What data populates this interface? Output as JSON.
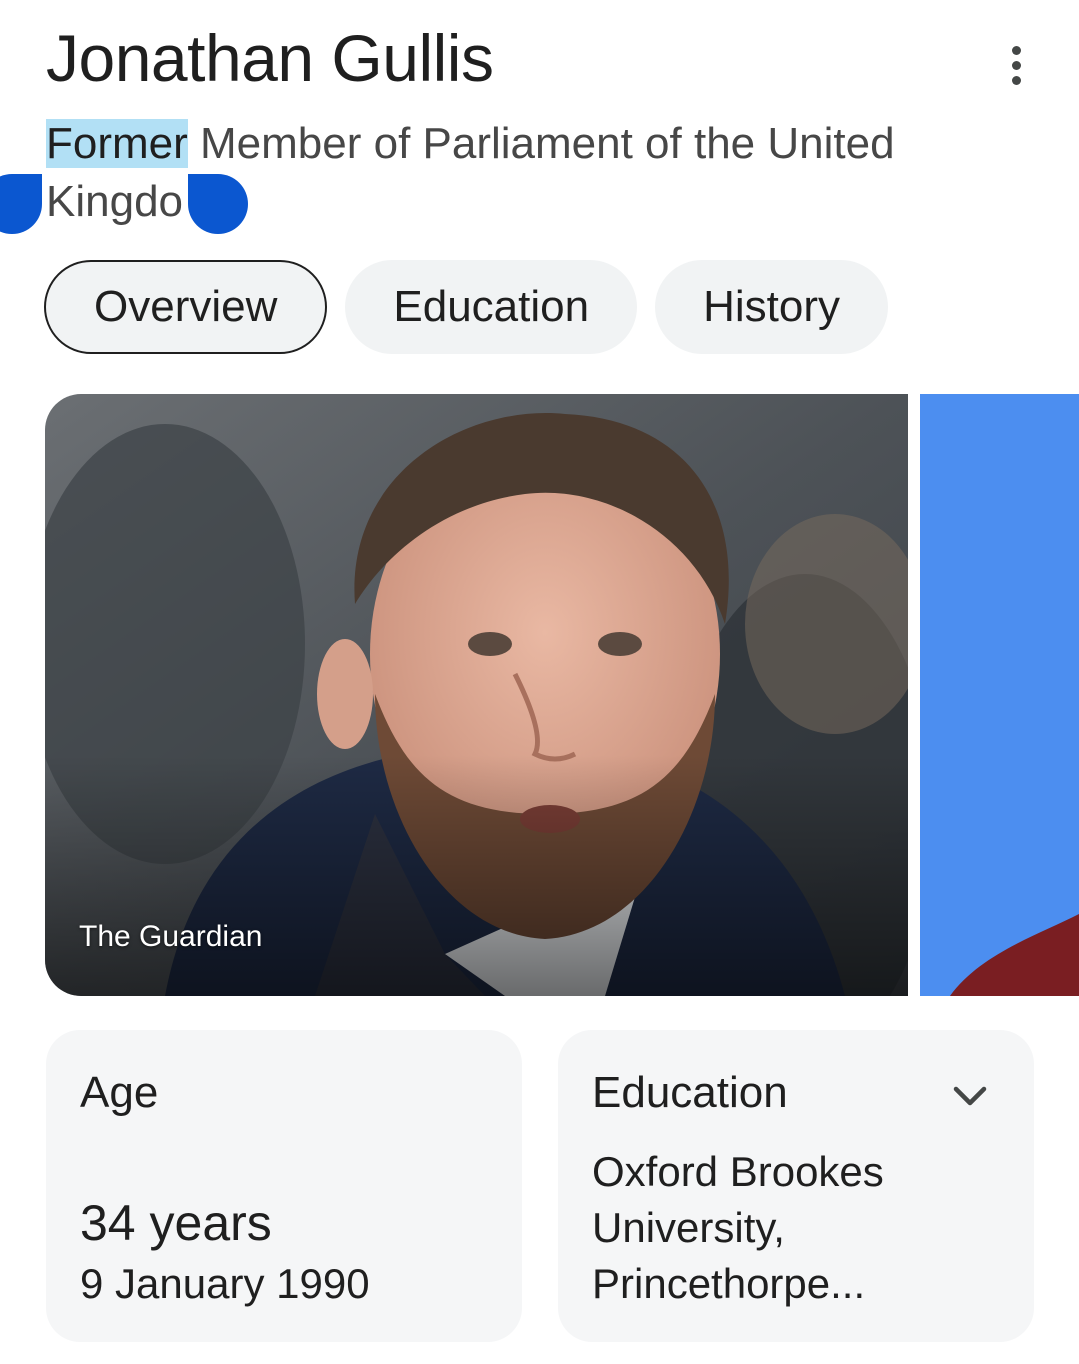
{
  "header": {
    "title": "Jonathan Gullis",
    "subtitle_highlight": "Former",
    "subtitle_line1_rest": " Member of Parliament of the United",
    "subtitle_line2": "Kingdo",
    "more_icon": "more-vert-icon"
  },
  "tabs": [
    {
      "label": "Overview",
      "active": true
    },
    {
      "label": "Education",
      "active": false
    },
    {
      "label": "History",
      "active": false
    }
  ],
  "images": {
    "main_credit": "The Guardian"
  },
  "cards": {
    "age": {
      "label": "Age",
      "value": "34 years",
      "date": "9 January 1990"
    },
    "education": {
      "label": "Education",
      "value": "Oxford Brookes University, Princethorpe...",
      "expand_icon": "chevron-down-icon"
    }
  },
  "colors": {
    "selection_highlight": "#b2e0f5",
    "selection_handle": "#0b57d0",
    "chip_bg": "#f1f3f4",
    "card_bg": "#f5f6f7"
  }
}
